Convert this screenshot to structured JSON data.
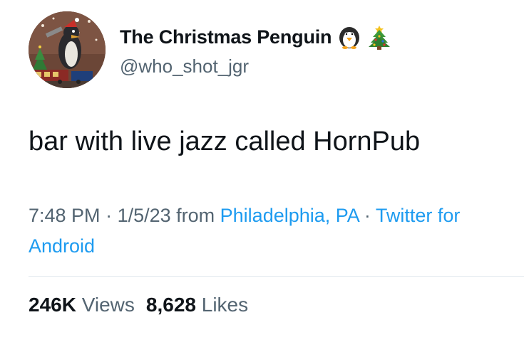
{
  "author": {
    "display_name": "The Christmas Penguin",
    "name_emojis": [
      "penguin-emoji",
      "christmas-tree-emoji"
    ],
    "handle": "@who_shot_jgr",
    "avatar": "penguin-with-train-avatar"
  },
  "tweet": {
    "text": "bar with live jazz called HornPub"
  },
  "meta": {
    "time": "7:48 PM",
    "separator1": " · ",
    "date": "1/5/23",
    "from_label": " from ",
    "location": "Philadelphia, PA",
    "separator2": " · ",
    "source_line1": "Twitter for",
    "source_line2": "Android"
  },
  "stats": {
    "views_count": "246K",
    "views_label": "Views",
    "likes_count": "8,628",
    "likes_label": "Likes"
  },
  "colors": {
    "text": "#0f1419",
    "secondary": "#536471",
    "link": "#1d9bf0",
    "divider": "#e1e8ed"
  }
}
